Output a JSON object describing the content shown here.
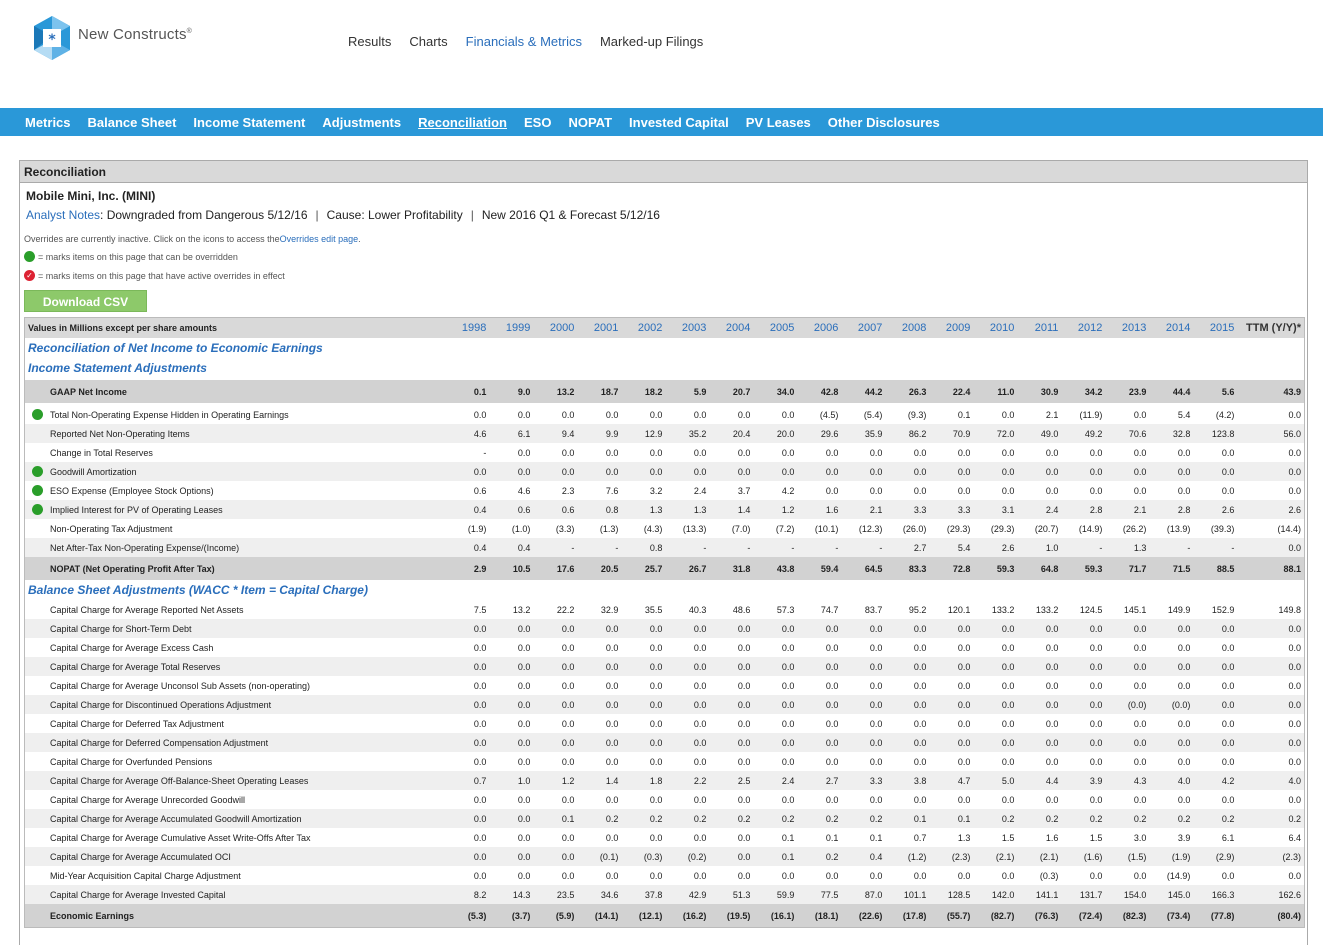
{
  "brand": {
    "name": "New Constructs",
    "reg": "®"
  },
  "topnav": [
    "Results",
    "Charts",
    "Financials & Metrics",
    "Marked-up Filings"
  ],
  "topnav_active": 2,
  "subnav": [
    "Metrics",
    "Balance Sheet",
    "Income Statement",
    "Adjustments",
    "Reconciliation",
    "ESO",
    "NOPAT",
    "Invested Capital",
    "PV Leases",
    "Other Disclosures"
  ],
  "subnav_active": 4,
  "panel_title": "Reconciliation",
  "company": "Mobile Mini, Inc. (MINI)",
  "notes": {
    "label": "Analyst Notes",
    "text": " : Downgraded from Dangerous 5/12/16",
    "cause": "Cause: Lower Profitability",
    "forecast": "New 2016 Q1 & Forecast 5/12/16"
  },
  "overrides": {
    "line1_a": "Overrides are currently inactive. Click on the icons to access the ",
    "line1_link": "Overrides edit page",
    "line1_b": ".",
    "line2": "= marks items on this page that can be overridden",
    "line3": "= marks items on this page that have active overrides in effect"
  },
  "csv_button": "Download CSV",
  "colors": {
    "accent": "#2a98d8",
    "link": "#2a6ebb",
    "green": "#2a9e2a",
    "red": "#d23"
  },
  "table": {
    "header_label": "Values in Millions except per share amounts",
    "years": [
      "1998",
      "1999",
      "2000",
      "2001",
      "2002",
      "2003",
      "2004",
      "2005",
      "2006",
      "2007",
      "2008",
      "2009",
      "2010",
      "2011",
      "2012",
      "2013",
      "2014",
      "2015"
    ],
    "ttm_label": "TTM (Y/Y)*",
    "section1": "Reconciliation of Net Income to Economic Earnings",
    "section1b": "Income Statement Adjustments",
    "gaap": {
      "label": "GAAP Net Income",
      "values": [
        "0.1",
        "9.0",
        "13.2",
        "18.7",
        "18.2",
        "5.9",
        "20.7",
        "34.0",
        "42.8",
        "44.2",
        "26.3",
        "22.4",
        "11.0",
        "30.9",
        "34.2",
        "23.9",
        "44.4",
        "5.6"
      ],
      "ttm": "43.9"
    },
    "is_rows": [
      {
        "label": "Total Non-Operating Expense Hidden in Operating Earnings",
        "dot": true,
        "values": [
          "0.0",
          "0.0",
          "0.0",
          "0.0",
          "0.0",
          "0.0",
          "0.0",
          "0.0",
          "(4.5)",
          "(5.4)",
          "(9.3)",
          "0.1",
          "0.0",
          "2.1",
          "(11.9)",
          "0.0",
          "5.4",
          "(4.2)"
        ],
        "ttm": "0.0"
      },
      {
        "label": "Reported Net Non-Operating Items",
        "dot": false,
        "values": [
          "4.6",
          "6.1",
          "9.4",
          "9.9",
          "12.9",
          "35.2",
          "20.4",
          "20.0",
          "29.6",
          "35.9",
          "86.2",
          "70.9",
          "72.0",
          "49.0",
          "49.2",
          "70.6",
          "32.8",
          "123.8"
        ],
        "ttm": "56.0"
      },
      {
        "label": "Change in Total Reserves",
        "dot": false,
        "values": [
          "-",
          "0.0",
          "0.0",
          "0.0",
          "0.0",
          "0.0",
          "0.0",
          "0.0",
          "0.0",
          "0.0",
          "0.0",
          "0.0",
          "0.0",
          "0.0",
          "0.0",
          "0.0",
          "0.0",
          "0.0"
        ],
        "ttm": "0.0"
      },
      {
        "label": "Goodwill Amortization",
        "dot": true,
        "values": [
          "0.0",
          "0.0",
          "0.0",
          "0.0",
          "0.0",
          "0.0",
          "0.0",
          "0.0",
          "0.0",
          "0.0",
          "0.0",
          "0.0",
          "0.0",
          "0.0",
          "0.0",
          "0.0",
          "0.0",
          "0.0"
        ],
        "ttm": "0.0"
      },
      {
        "label": "ESO Expense (Employee Stock Options)",
        "dot": true,
        "values": [
          "0.6",
          "4.6",
          "2.3",
          "7.6",
          "3.2",
          "2.4",
          "3.7",
          "4.2",
          "0.0",
          "0.0",
          "0.0",
          "0.0",
          "0.0",
          "0.0",
          "0.0",
          "0.0",
          "0.0",
          "0.0"
        ],
        "ttm": "0.0"
      },
      {
        "label": "Implied Interest for PV of Operating Leases",
        "dot": true,
        "values": [
          "0.4",
          "0.6",
          "0.6",
          "0.8",
          "1.3",
          "1.3",
          "1.4",
          "1.2",
          "1.6",
          "2.1",
          "3.3",
          "3.3",
          "3.1",
          "2.4",
          "2.8",
          "2.1",
          "2.8",
          "2.6"
        ],
        "ttm": "2.6"
      },
      {
        "label": "Non-Operating Tax Adjustment",
        "dot": false,
        "values": [
          "(1.9)",
          "(1.0)",
          "(3.3)",
          "(1.3)",
          "(4.3)",
          "(13.3)",
          "(7.0)",
          "(7.2)",
          "(10.1)",
          "(12.3)",
          "(26.0)",
          "(29.3)",
          "(29.3)",
          "(20.7)",
          "(14.9)",
          "(26.2)",
          "(13.9)",
          "(39.3)"
        ],
        "ttm": "(14.4)"
      },
      {
        "label": "Net After-Tax Non-Operating Expense/(Income)",
        "dot": false,
        "values": [
          "0.4",
          "0.4",
          "-",
          "-",
          "0.8",
          "-",
          "-",
          "-",
          "-",
          "-",
          "2.7",
          "5.4",
          "2.6",
          "1.0",
          "-",
          "1.3",
          "-",
          "-"
        ],
        "ttm": "0.0"
      }
    ],
    "nopat": {
      "label": "NOPAT (Net Operating Profit After Tax)",
      "values": [
        "2.9",
        "10.5",
        "17.6",
        "20.5",
        "25.7",
        "26.7",
        "31.8",
        "43.8",
        "59.4",
        "64.5",
        "83.3",
        "72.8",
        "59.3",
        "64.8",
        "59.3",
        "71.7",
        "71.5",
        "88.5"
      ],
      "ttm": "88.1"
    },
    "section2": "Balance Sheet Adjustments (WACC * Item = Capital Charge)",
    "bs_rows": [
      {
        "label": "Capital Charge for Average Reported Net Assets",
        "values": [
          "7.5",
          "13.2",
          "22.2",
          "32.9",
          "35.5",
          "40.3",
          "48.6",
          "57.3",
          "74.7",
          "83.7",
          "95.2",
          "120.1",
          "133.2",
          "133.2",
          "124.5",
          "145.1",
          "149.9",
          "152.9"
        ],
        "ttm": "149.8"
      },
      {
        "label": "Capital Charge for Short-Term Debt",
        "values": [
          "0.0",
          "0.0",
          "0.0",
          "0.0",
          "0.0",
          "0.0",
          "0.0",
          "0.0",
          "0.0",
          "0.0",
          "0.0",
          "0.0",
          "0.0",
          "0.0",
          "0.0",
          "0.0",
          "0.0",
          "0.0"
        ],
        "ttm": "0.0"
      },
      {
        "label": "Capital Charge for Average Excess Cash",
        "values": [
          "0.0",
          "0.0",
          "0.0",
          "0.0",
          "0.0",
          "0.0",
          "0.0",
          "0.0",
          "0.0",
          "0.0",
          "0.0",
          "0.0",
          "0.0",
          "0.0",
          "0.0",
          "0.0",
          "0.0",
          "0.0"
        ],
        "ttm": "0.0"
      },
      {
        "label": "Capital Charge for Average Total Reserves",
        "values": [
          "0.0",
          "0.0",
          "0.0",
          "0.0",
          "0.0",
          "0.0",
          "0.0",
          "0.0",
          "0.0",
          "0.0",
          "0.0",
          "0.0",
          "0.0",
          "0.0",
          "0.0",
          "0.0",
          "0.0",
          "0.0"
        ],
        "ttm": "0.0"
      },
      {
        "label": "Capital Charge for Average Unconsol Sub Assets (non-operating)",
        "values": [
          "0.0",
          "0.0",
          "0.0",
          "0.0",
          "0.0",
          "0.0",
          "0.0",
          "0.0",
          "0.0",
          "0.0",
          "0.0",
          "0.0",
          "0.0",
          "0.0",
          "0.0",
          "0.0",
          "0.0",
          "0.0"
        ],
        "ttm": "0.0"
      },
      {
        "label": "Capital Charge for Discontinued Operations Adjustment",
        "values": [
          "0.0",
          "0.0",
          "0.0",
          "0.0",
          "0.0",
          "0.0",
          "0.0",
          "0.0",
          "0.0",
          "0.0",
          "0.0",
          "0.0",
          "0.0",
          "0.0",
          "0.0",
          "(0.0)",
          "(0.0)",
          "0.0"
        ],
        "ttm": "0.0"
      },
      {
        "label": "Capital Charge for Deferred Tax Adjustment",
        "values": [
          "0.0",
          "0.0",
          "0.0",
          "0.0",
          "0.0",
          "0.0",
          "0.0",
          "0.0",
          "0.0",
          "0.0",
          "0.0",
          "0.0",
          "0.0",
          "0.0",
          "0.0",
          "0.0",
          "0.0",
          "0.0"
        ],
        "ttm": "0.0"
      },
      {
        "label": "Capital Charge for Deferred Compensation Adjustment",
        "values": [
          "0.0",
          "0.0",
          "0.0",
          "0.0",
          "0.0",
          "0.0",
          "0.0",
          "0.0",
          "0.0",
          "0.0",
          "0.0",
          "0.0",
          "0.0",
          "0.0",
          "0.0",
          "0.0",
          "0.0",
          "0.0"
        ],
        "ttm": "0.0"
      },
      {
        "label": "Capital Charge for Overfunded Pensions",
        "values": [
          "0.0",
          "0.0",
          "0.0",
          "0.0",
          "0.0",
          "0.0",
          "0.0",
          "0.0",
          "0.0",
          "0.0",
          "0.0",
          "0.0",
          "0.0",
          "0.0",
          "0.0",
          "0.0",
          "0.0",
          "0.0"
        ],
        "ttm": "0.0"
      },
      {
        "label": "Capital Charge for Average Off-Balance-Sheet Operating Leases",
        "values": [
          "0.7",
          "1.0",
          "1.2",
          "1.4",
          "1.8",
          "2.2",
          "2.5",
          "2.4",
          "2.7",
          "3.3",
          "3.8",
          "4.7",
          "5.0",
          "4.4",
          "3.9",
          "4.3",
          "4.0",
          "4.2"
        ],
        "ttm": "4.0"
      },
      {
        "label": "Capital Charge for Average Unrecorded Goodwill",
        "values": [
          "0.0",
          "0.0",
          "0.0",
          "0.0",
          "0.0",
          "0.0",
          "0.0",
          "0.0",
          "0.0",
          "0.0",
          "0.0",
          "0.0",
          "0.0",
          "0.0",
          "0.0",
          "0.0",
          "0.0",
          "0.0"
        ],
        "ttm": "0.0"
      },
      {
        "label": "Capital Charge for Average Accumulated Goodwill Amortization",
        "values": [
          "0.0",
          "0.0",
          "0.1",
          "0.2",
          "0.2",
          "0.2",
          "0.2",
          "0.2",
          "0.2",
          "0.2",
          "0.1",
          "0.1",
          "0.2",
          "0.2",
          "0.2",
          "0.2",
          "0.2",
          "0.2"
        ],
        "ttm": "0.2"
      },
      {
        "label": "Capital Charge for Average Cumulative Asset Write-Offs After Tax",
        "values": [
          "0.0",
          "0.0",
          "0.0",
          "0.0",
          "0.0",
          "0.0",
          "0.0",
          "0.1",
          "0.1",
          "0.1",
          "0.7",
          "1.3",
          "1.5",
          "1.6",
          "1.5",
          "3.0",
          "3.9",
          "6.1"
        ],
        "ttm": "6.4"
      },
      {
        "label": "Capital Charge for Average Accumulated OCI",
        "values": [
          "0.0",
          "0.0",
          "0.0",
          "(0.1)",
          "(0.3)",
          "(0.2)",
          "0.0",
          "0.1",
          "0.2",
          "0.4",
          "(1.2)",
          "(2.3)",
          "(2.1)",
          "(2.1)",
          "(1.6)",
          "(1.5)",
          "(1.9)",
          "(2.9)"
        ],
        "ttm": "(2.3)"
      },
      {
        "label": "Mid-Year Acquisition Capital Charge Adjustment",
        "values": [
          "0.0",
          "0.0",
          "0.0",
          "0.0",
          "0.0",
          "0.0",
          "0.0",
          "0.0",
          "0.0",
          "0.0",
          "0.0",
          "0.0",
          "0.0",
          "(0.3)",
          "0.0",
          "0.0",
          "(14.9)",
          "0.0"
        ],
        "ttm": "0.0"
      },
      {
        "label": "Capital Charge for Average Invested Capital",
        "values": [
          "8.2",
          "14.3",
          "23.5",
          "34.6",
          "37.8",
          "42.9",
          "51.3",
          "59.9",
          "77.5",
          "87.0",
          "101.1",
          "128.5",
          "142.0",
          "141.1",
          "131.7",
          "154.0",
          "145.0",
          "166.3"
        ],
        "ttm": "162.6"
      }
    ],
    "ee": {
      "label": "Economic Earnings",
      "values": [
        "(5.3)",
        "(3.7)",
        "(5.9)",
        "(14.1)",
        "(12.1)",
        "(16.2)",
        "(19.5)",
        "(16.1)",
        "(18.1)",
        "(22.6)",
        "(17.8)",
        "(55.7)",
        "(82.7)",
        "(76.3)",
        "(72.4)",
        "(82.3)",
        "(73.4)",
        "(77.8)"
      ],
      "ttm": "(80.4)"
    }
  }
}
